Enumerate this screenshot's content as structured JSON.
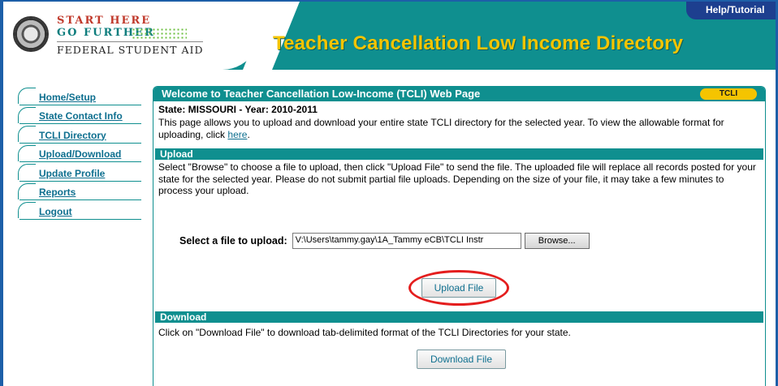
{
  "header": {
    "logo_line1": "START HERE",
    "logo_line2": "GO FURTHER",
    "logo_line3": "FEDERAL STUDENT AID",
    "site_title": "Teacher Cancellation Low Income Directory",
    "help_link": "Help/Tutorial",
    "colors": {
      "teal": "#0f8f8f",
      "title_yellow": "#f5c400",
      "help_blue": "#1d3f8f"
    }
  },
  "sidebar": {
    "items": [
      {
        "label": "Home/Setup"
      },
      {
        "label": "State Contact Info"
      },
      {
        "label": "TCLI Directory"
      },
      {
        "label": "Upload/Download"
      },
      {
        "label": "Update Profile"
      },
      {
        "label": "Reports"
      },
      {
        "label": "Logout"
      }
    ]
  },
  "main": {
    "panel_title": "Welcome to Teacher Cancellation Low-Income (TCLI) Web Page",
    "badge": "TCLI",
    "state_line": "State: MISSOURI - Year: 2010-2011",
    "intro_text": "This page allows you to upload and download your entire state TCLI directory for the selected year. To view the allowable format for uploading, click",
    "intro_link": "here",
    "intro_end": ".",
    "upload": {
      "section_title": "Upload",
      "instructions": "Select \"Browse\" to choose a file to upload, then click \"Upload File\" to send the file. The uploaded file will replace all records posted for your state for the selected year. Please do not submit partial file uploads. Depending on the size of your file, it may take a few minutes to process your upload.",
      "file_label": "Select a file to upload:",
      "file_value": "V:\\Users\\tammy.gay\\1A_Tammy eCB\\TCLI Instr",
      "browse_label": "Browse...",
      "upload_button": "Upload File"
    },
    "download": {
      "section_title": "Download",
      "instructions": "Click on \"Download File\" to download tab-delimited format of the TCLI Directories for your state.",
      "download_button": "Download File"
    },
    "highlight_color": "#e41e1e"
  }
}
